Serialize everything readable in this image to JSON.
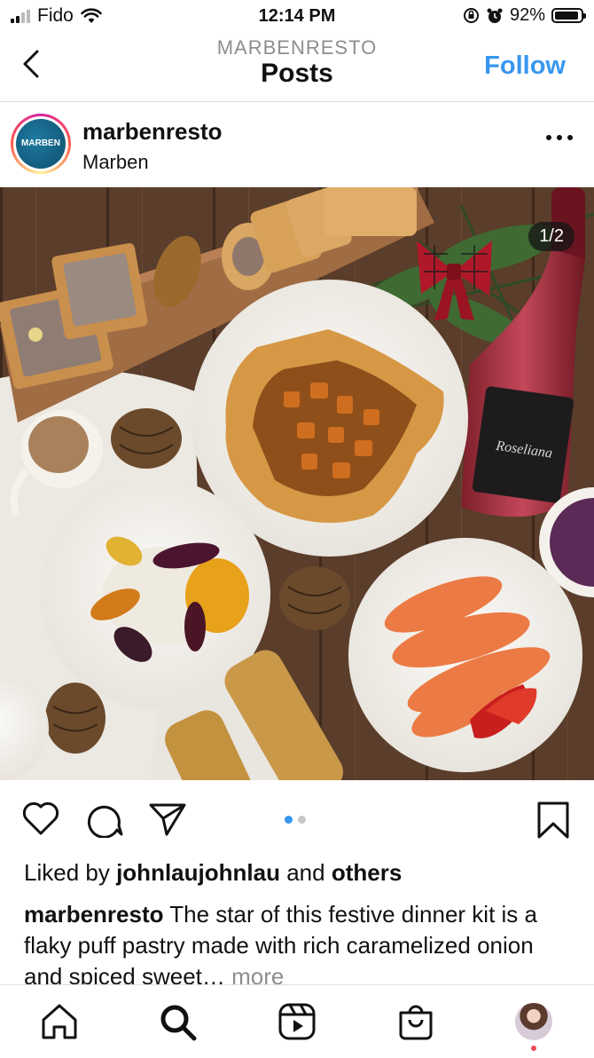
{
  "status_bar": {
    "carrier": "Fido",
    "time": "12:14 PM",
    "battery": "92%",
    "battery_level": 0.92
  },
  "header": {
    "subtitle": "MARBENRESTO",
    "title": "Posts",
    "follow_label": "Follow"
  },
  "post": {
    "avatar_text": "MARBEN",
    "username": "marbenresto",
    "location": "Marben",
    "image_counter": "1/2",
    "wine_label": "Roseliana",
    "liked_prefix": "Liked by",
    "liked_user": "johnlaujohnlau",
    "liked_and": "and",
    "liked_others": "others",
    "caption_user": "marbenresto",
    "caption_text": " The star of this festive dinner kit is a flaky puff pastry made with rich caramelized onion and spiced sweet…",
    "caption_more": " more"
  },
  "icons": {
    "back": "chevron-left-icon",
    "more": "more-dots-icon",
    "like": "heart-icon",
    "comment": "comment-icon",
    "share": "send-icon",
    "save": "bookmark-icon",
    "home": "home-icon",
    "search": "search-icon",
    "reels": "reels-icon",
    "shop": "shop-icon"
  },
  "carousel": {
    "total": 2,
    "active": 1
  },
  "colors": {
    "accent": "#3897f0",
    "notification": "#ed4956"
  }
}
